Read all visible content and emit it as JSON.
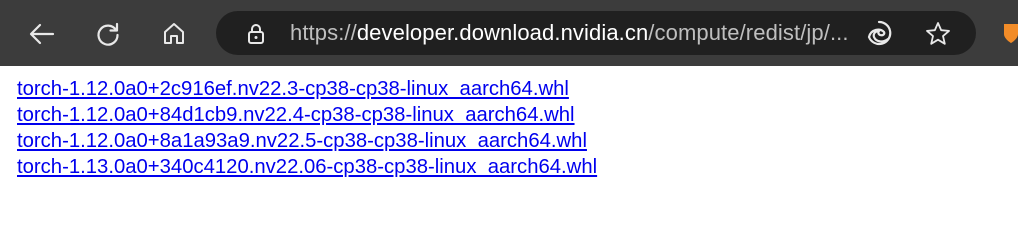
{
  "toolbar": {
    "url_prefix": "https://",
    "url_host": "developer.download.nvidia.cn",
    "url_path": "/compute/redist/jp/...",
    "icons": {
      "back": "back-arrow-icon",
      "reload": "reload-icon",
      "home": "home-icon",
      "lock": "site-info-lock-icon",
      "edge": "edge-logo-icon",
      "favorite": "star-icon",
      "extension": "extension-icon"
    },
    "colors": {
      "toolbar_bg": "#3c3c3c",
      "omnibox_bg": "#202020",
      "link": "#0000ee"
    }
  },
  "content": {
    "links": [
      "torch-1.12.0a0+2c916ef.nv22.3-cp38-cp38-linux_aarch64.whl",
      "torch-1.12.0a0+84d1cb9.nv22.4-cp38-cp38-linux_aarch64.whl",
      "torch-1.12.0a0+8a1a93a9.nv22.5-cp38-cp38-linux_aarch64.whl",
      "torch-1.13.0a0+340c4120.nv22.06-cp38-cp38-linux_aarch64.whl"
    ]
  }
}
